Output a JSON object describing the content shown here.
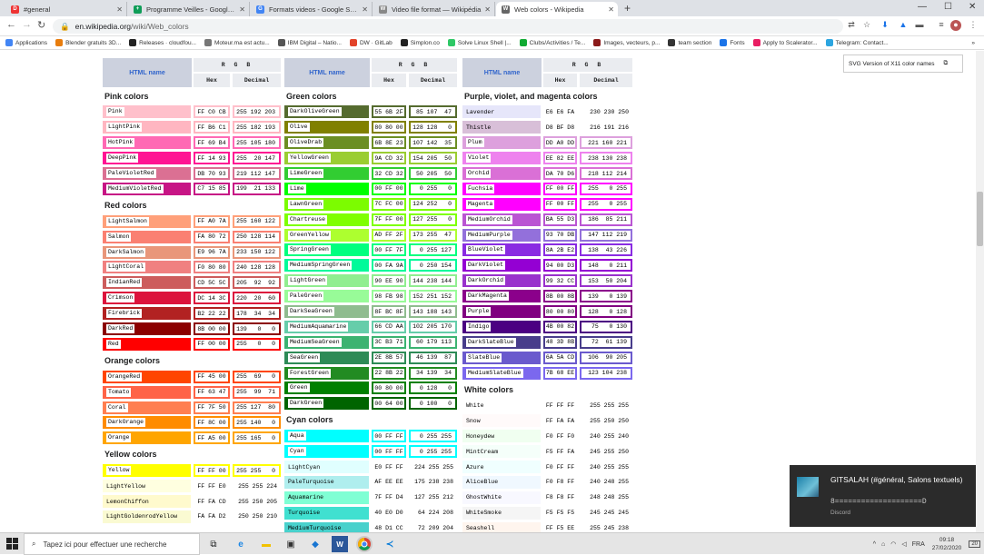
{
  "browser": {
    "tabs": [
      {
        "title": "#general",
        "color": "#e33",
        "glyph": "D"
      },
      {
        "title": "Programme Veilles - Google She",
        "color": "#0f9d58",
        "glyph": "+"
      },
      {
        "title": "Formats videos - Google Search",
        "color": "#4285f4",
        "glyph": "G"
      },
      {
        "title": "Video file format — Wikipédia",
        "color": "#888",
        "glyph": "W"
      },
      {
        "title": "Web colors - Wikipedia",
        "color": "#666",
        "glyph": "W"
      }
    ],
    "url_host": "en.wikipedia.org",
    "url_path": "/wiki/Web_colors",
    "bookmarks": [
      {
        "label": "Applications",
        "color": "#4285f4"
      },
      {
        "label": "Blender gratuits 3D...",
        "color": "#e87d0d"
      },
      {
        "label": "Releases · cloudfou...",
        "color": "#222"
      },
      {
        "label": "Moteur.ma est actu...",
        "color": "#777"
      },
      {
        "label": "IBM Digital – Natio...",
        "color": "#555"
      },
      {
        "label": "DW · GitLab",
        "color": "#e24329"
      },
      {
        "label": "Simplon.co",
        "color": "#222"
      },
      {
        "label": "Solve Linux Shell |...",
        "color": "#2ec866"
      },
      {
        "label": "Clubs/Activities / Te...",
        "color": "#1a3"
      },
      {
        "label": "Images, vecteurs, p...",
        "color": "#8b1a1a"
      },
      {
        "label": "team section",
        "color": "#333"
      },
      {
        "label": "Fonts",
        "color": "#1a73e8"
      },
      {
        "label": "Apply to Scalerator...",
        "color": "#e91e63"
      },
      {
        "label": "Telegram: Contact...",
        "color": "#2ca5e0"
      }
    ],
    "bookmarks_more": "»"
  },
  "table_headers": {
    "html_name": "HTML name",
    "rgb": "R G B",
    "hex": "Hex",
    "decimal": "Decimal"
  },
  "svg_version_label": "SVG Version of X11 color names",
  "columns": [
    {
      "groups": [
        {
          "title": "Pink colors",
          "rows": [
            [
              "Pink",
              "FF C0 CB",
              "255 192 203",
              "#FFC0CB",
              "#000"
            ],
            [
              "LightPink",
              "FF B6 C1",
              "255 182 193",
              "#FFB6C1",
              "#000"
            ],
            [
              "HotPink",
              "FF 69 B4",
              "255 105 180",
              "#FF69B4",
              "#000"
            ],
            [
              "DeepPink",
              "FF 14 93",
              "255  20 147",
              "#FF1493",
              "#fff"
            ],
            [
              "PaleVioletRed",
              "DB 70 93",
              "219 112 147",
              "#DB7093",
              "#fff"
            ],
            [
              "MediumVioletRed",
              "C7 15 85",
              "199  21 133",
              "#C71585",
              "#fff"
            ]
          ]
        },
        {
          "title": "Red colors",
          "rows": [
            [
              "LightSalmon",
              "FF A0 7A",
              "255 160 122",
              "#FFA07A",
              "#000"
            ],
            [
              "Salmon",
              "FA 80 72",
              "250 128 114",
              "#FA8072",
              "#000"
            ],
            [
              "DarkSalmon",
              "E9 96 7A",
              "233 150 122",
              "#E9967A",
              "#000"
            ],
            [
              "LightCoral",
              "F0 80 80",
              "240 128 128",
              "#F08080",
              "#000"
            ],
            [
              "IndianRed",
              "CD 5C 5C",
              "205  92  92",
              "#CD5C5C",
              "#fff"
            ],
            [
              "Crimson",
              "DC 14 3C",
              "220  20  60",
              "#DC143C",
              "#fff"
            ],
            [
              "Firebrick",
              "B2 22 22",
              "178  34  34",
              "#B22222",
              "#fff"
            ],
            [
              "DarkRed",
              "8B 00 00",
              "139   0   0",
              "#8B0000",
              "#fff"
            ],
            [
              "Red",
              "FF 00 00",
              "255   0   0",
              "#FF0000",
              "#fff"
            ]
          ]
        },
        {
          "title": "Orange colors",
          "rows": [
            [
              "OrangeRed",
              "FF 45 00",
              "255  69   0",
              "#FF4500",
              "#fff"
            ],
            [
              "Tomato",
              "FF 63 47",
              "255  99  71",
              "#FF6347",
              "#fff"
            ],
            [
              "Coral",
              "FF 7F 50",
              "255 127  80",
              "#FF7F50",
              "#000"
            ],
            [
              "DarkOrange",
              "FF 8C 00",
              "255 140   0",
              "#FF8C00",
              "#000"
            ],
            [
              "Orange",
              "FF A5 00",
              "255 165   0",
              "#FFA500",
              "#000"
            ]
          ]
        },
        {
          "title": "Yellow colors",
          "rows": [
            [
              "Yellow",
              "FF FF 00",
              "255 255   0",
              "#FFFF00",
              "#000"
            ],
            [
              "LightYellow",
              "FF FF E0",
              "255 255 224",
              "#FFFFE0",
              "#000",
              1
            ],
            [
              "LemonChiffon",
              "FF FA CD",
              "255 250 205",
              "#FFFACD",
              "#000",
              1
            ],
            [
              "LightGoldenrodYellow",
              "FA FA D2",
              "250 250 210",
              "#FAFAD2",
              "#000",
              1
            ]
          ]
        }
      ]
    },
    {
      "groups": [
        {
          "title": "Green colors",
          "rows": [
            [
              "DarkOliveGreen",
              "55 6B 2F",
              " 85 107  47",
              "#556B2F",
              "#fff"
            ],
            [
              "Olive",
              "80 80 00",
              "128 128   0",
              "#808000",
              "#fff"
            ],
            [
              "OliveDrab",
              "6B 8E 23",
              "107 142  35",
              "#6B8E23",
              "#fff"
            ],
            [
              "YellowGreen",
              "9A CD 32",
              "154 205  50",
              "#9ACD32",
              "#000"
            ],
            [
              "LimeGreen",
              "32 CD 32",
              " 50 205  50",
              "#32CD32",
              "#000"
            ],
            [
              "Lime",
              "00 FF 00",
              "  0 255   0",
              "#00FF00",
              "#000"
            ],
            [
              "LawnGreen",
              "7C FC 00",
              "124 252   0",
              "#7CFC00",
              "#000"
            ],
            [
              "Chartreuse",
              "7F FF 00",
              "127 255   0",
              "#7FFF00",
              "#000"
            ],
            [
              "GreenYellow",
              "AD FF 2F",
              "173 255  47",
              "#ADFF2F",
              "#000"
            ],
            [
              "SpringGreen",
              "00 FF 7F",
              "  0 255 127",
              "#00FF7F",
              "#000"
            ],
            [
              "MediumSpringGreen",
              "00 FA 9A",
              "  0 250 154",
              "#00FA9A",
              "#000"
            ],
            [
              "LightGreen",
              "90 EE 90",
              "144 238 144",
              "#90EE90",
              "#000"
            ],
            [
              "PaleGreen",
              "98 FB 98",
              "152 251 152",
              "#98FB98",
              "#000"
            ],
            [
              "DarkSeaGreen",
              "8F BC 8F",
              "143 188 143",
              "#8FBC8F",
              "#000"
            ],
            [
              "MediumAquamarine",
              "66 CD AA",
              "102 205 170",
              "#66CDAA",
              "#000"
            ],
            [
              "MediumSeaGreen",
              "3C B3 71",
              " 60 179 113",
              "#3CB371",
              "#000"
            ],
            [
              "SeaGreen",
              "2E 8B 57",
              " 46 139  87",
              "#2E8B57",
              "#fff"
            ],
            [
              "ForestGreen",
              "22 8B 22",
              " 34 139  34",
              "#228B22",
              "#fff"
            ],
            [
              "Green",
              "00 80 00",
              "  0 128   0",
              "#008000",
              "#fff"
            ],
            [
              "DarkGreen",
              "00 64 00",
              "  0 100   0",
              "#006400",
              "#fff"
            ]
          ]
        },
        {
          "title": "Cyan colors",
          "rows": [
            [
              "Aqua",
              "00 FF FF",
              "  0 255 255",
              "#00FFFF",
              "#000"
            ],
            [
              "Cyan",
              "00 FF FF",
              "  0 255 255",
              "#00FFFF",
              "#000"
            ],
            [
              "LightCyan",
              "E0 FF FF",
              "224 255 255",
              "#E0FFFF",
              "#000",
              1
            ],
            [
              "PaleTurquoise",
              "AF EE EE",
              "175 238 238",
              "#AFEEEE",
              "#000",
              1
            ],
            [
              "Aquamarine",
              "7F FF D4",
              "127 255 212",
              "#7FFFD4",
              "#000",
              1
            ],
            [
              "Turquoise",
              "40 E0 D0",
              " 64 224 208",
              "#40E0D0",
              "#000",
              1
            ],
            [
              "MediumTurquoise",
              "48 D1 CC",
              " 72 209 204",
              "#48D1CC",
              "#000",
              1
            ]
          ]
        }
      ]
    },
    {
      "groups": [
        {
          "title": "Purple, violet, and magenta colors",
          "rows": [
            [
              "Lavender",
              "E6 E6 FA",
              "230 230 250",
              "#E6E6FA",
              "#000",
              1
            ],
            [
              "Thistle",
              "D8 BF D8",
              "216 191 216",
              "#D8BFD8",
              "#000",
              1
            ],
            [
              "Plum",
              "DD A0 DD",
              "221 160 221",
              "#DDA0DD",
              "#000"
            ],
            [
              "Violet",
              "EE 82 EE",
              "238 130 238",
              "#EE82EE",
              "#000"
            ],
            [
              "Orchid",
              "DA 70 D6",
              "218 112 214",
              "#DA70D6",
              "#000"
            ],
            [
              "Fuchsia",
              "FF 00 FF",
              "255   0 255",
              "#FF00FF",
              "#fff"
            ],
            [
              "Magenta",
              "FF 00 FF",
              "255   0 255",
              "#FF00FF",
              "#fff"
            ],
            [
              "MediumOrchid",
              "BA 55 D3",
              "186  85 211",
              "#BA55D3",
              "#fff"
            ],
            [
              "MediumPurple",
              "93 70 DB",
              "147 112 219",
              "#9370DB",
              "#fff"
            ],
            [
              "BlueViolet",
              "8A 2B E2",
              "138  43 226",
              "#8A2BE2",
              "#fff"
            ],
            [
              "DarkViolet",
              "94 00 D3",
              "148   0 211",
              "#9400D3",
              "#fff"
            ],
            [
              "DarkOrchid",
              "99 32 CC",
              "153  50 204",
              "#9932CC",
              "#fff"
            ],
            [
              "DarkMagenta",
              "8B 00 8B",
              "139   0 139",
              "#8B008B",
              "#fff"
            ],
            [
              "Purple",
              "80 00 80",
              "128   0 128",
              "#800080",
              "#fff"
            ],
            [
              "Indigo",
              "4B 00 82",
              " 75   0 130",
              "#4B0082",
              "#fff"
            ],
            [
              "DarkSlateBlue",
              "48 3D 8B",
              " 72  61 139",
              "#483D8B",
              "#fff"
            ],
            [
              "SlateBlue",
              "6A 5A CD",
              "106  90 205",
              "#6A5ACD",
              "#fff"
            ],
            [
              "MediumSlateBlue",
              "7B 68 EE",
              "123 104 238",
              "#7B68EE",
              "#fff"
            ]
          ]
        },
        {
          "title": "White colors",
          "rows": [
            [
              "White",
              "FF FF FF",
              "255 255 255",
              "#FFFFFF",
              "#000",
              1
            ],
            [
              "Snow",
              "FF FA FA",
              "255 250 250",
              "#FFFAFA",
              "#000",
              1
            ],
            [
              "Honeydew",
              "F0 FF F0",
              "240 255 240",
              "#F0FFF0",
              "#000",
              1
            ],
            [
              "MintCream",
              "F5 FF FA",
              "245 255 250",
              "#F5FFFA",
              "#000",
              1
            ],
            [
              "Azure",
              "F0 FF FF",
              "240 255 255",
              "#F0FFFF",
              "#000",
              1
            ],
            [
              "AliceBlue",
              "F0 F8 FF",
              "240 248 255",
              "#F0F8FF",
              "#000",
              1
            ],
            [
              "GhostWhite",
              "F8 F8 FF",
              "248 248 255",
              "#F8F8FF",
              "#000",
              1
            ],
            [
              "WhiteSmoke",
              "F5 F5 F5",
              "245 245 245",
              "#F5F5F5",
              "#000",
              1
            ],
            [
              "Seashell",
              "FF F5 EE",
              "255 245 238",
              "#FFF5EE",
              "#000",
              1
            ]
          ]
        }
      ]
    }
  ],
  "toast": {
    "title": "GITSALAH (#général, Salons textuels)",
    "message": "8====================D",
    "app": "Discord"
  },
  "taskbar": {
    "search_placeholder": "Tapez ici pour effectuer une recherche",
    "time": "09:18",
    "date": "27/02/2020",
    "lang": "FRA",
    "notif_count": "20"
  }
}
